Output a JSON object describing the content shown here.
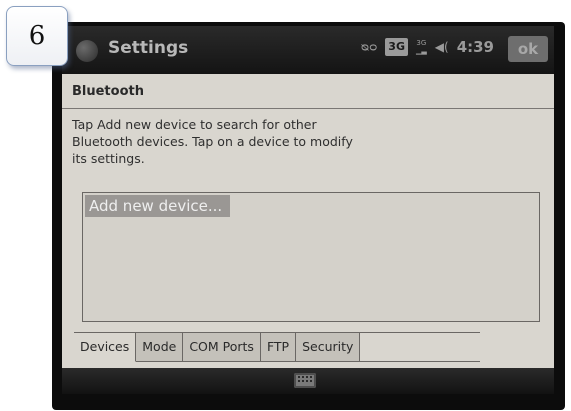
{
  "page_badge": {
    "number": "6"
  },
  "titlebar": {
    "logo_icon": "windows-logo-icon",
    "title": "Settings",
    "status_icons": [
      {
        "name": "link-icon",
        "text": "ᴓᴑ"
      },
      {
        "name": "3g-icon",
        "text": "3G"
      },
      {
        "name": "signal-icon",
        "text": "3G"
      },
      {
        "name": "volume-icon",
        "text": "◀("
      }
    ],
    "time": "4:39",
    "ok_label": "ok"
  },
  "page": {
    "heading": "Bluetooth",
    "instructions": "Tap Add new device to search for other\nBluetooth devices. Tap on a device to modify\nits settings."
  },
  "device_list": {
    "items": [
      "Add new device..."
    ]
  },
  "tabs": [
    {
      "label": "Devices",
      "active": true
    },
    {
      "label": "Mode",
      "active": false
    },
    {
      "label": "COM Ports",
      "active": false
    },
    {
      "label": "FTP",
      "active": false
    },
    {
      "label": "Security",
      "active": false
    }
  ],
  "bottombar": {
    "input_icon": "keyboard-icon"
  },
  "colors": {
    "screen_background": "#d9d6cf",
    "titlebar": "#1c1c1c",
    "selection": "#9a9794"
  }
}
